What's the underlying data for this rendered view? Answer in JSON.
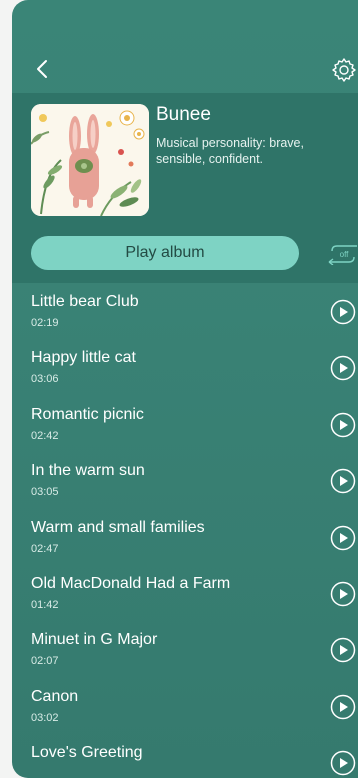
{
  "header": {
    "back_icon": "chevron-left-icon",
    "settings_icon": "gear-icon"
  },
  "album": {
    "title": "Bunee",
    "description": "Musical personality: brave, sensible, confident.",
    "play_label": "Play album",
    "loop_label": "off"
  },
  "tracks": [
    {
      "title": "Little bear Club",
      "duration": "02:19"
    },
    {
      "title": "Happy little cat",
      "duration": "03:06"
    },
    {
      "title": "Romantic picnic",
      "duration": "02:42"
    },
    {
      "title": "In the warm sun",
      "duration": "03:05"
    },
    {
      "title": "Warm and small families",
      "duration": "02:47"
    },
    {
      "title": "Old MacDonald Had a Farm",
      "duration": "01:42"
    },
    {
      "title": "Minuet in G Major",
      "duration": "02:07"
    },
    {
      "title": "Canon",
      "duration": "03:02"
    },
    {
      "title": "Love's Greeting",
      "duration": ""
    }
  ],
  "colors": {
    "background": "#3a8577",
    "header_band": "#2f7468",
    "accent": "#7ed3c4"
  }
}
